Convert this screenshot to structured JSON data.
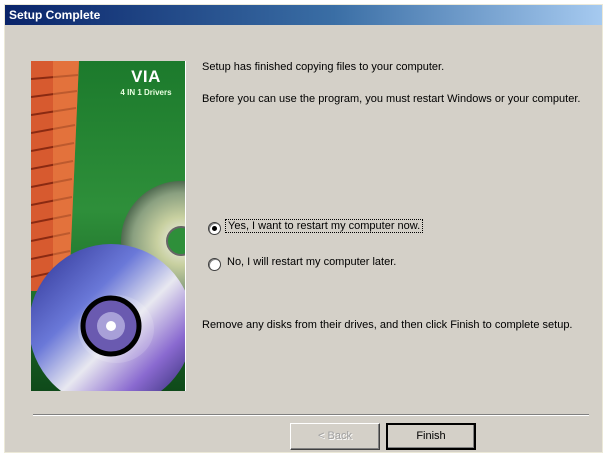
{
  "window": {
    "title": "Setup Complete"
  },
  "banner": {
    "brand_name": "VIA",
    "brand_subtitle": "4 IN 1 Drivers"
  },
  "content": {
    "message1": "Setup has finished copying files to your computer.",
    "message2": "Before you can use the program, you must restart Windows or your computer.",
    "options": [
      {
        "label": "Yes, I want to restart my computer now.",
        "selected": true
      },
      {
        "label": "No, I will restart my computer later.",
        "selected": false
      }
    ],
    "message3": "Remove any disks from their drives, and then click Finish to complete setup."
  },
  "buttons": {
    "back_label": "< Back",
    "finish_label": "Finish"
  },
  "colors": {
    "title_start": "#0a246a",
    "title_end": "#a6caf0",
    "dialog_bg": "#d4d0c8",
    "banner_green": "#1c7a2c"
  }
}
